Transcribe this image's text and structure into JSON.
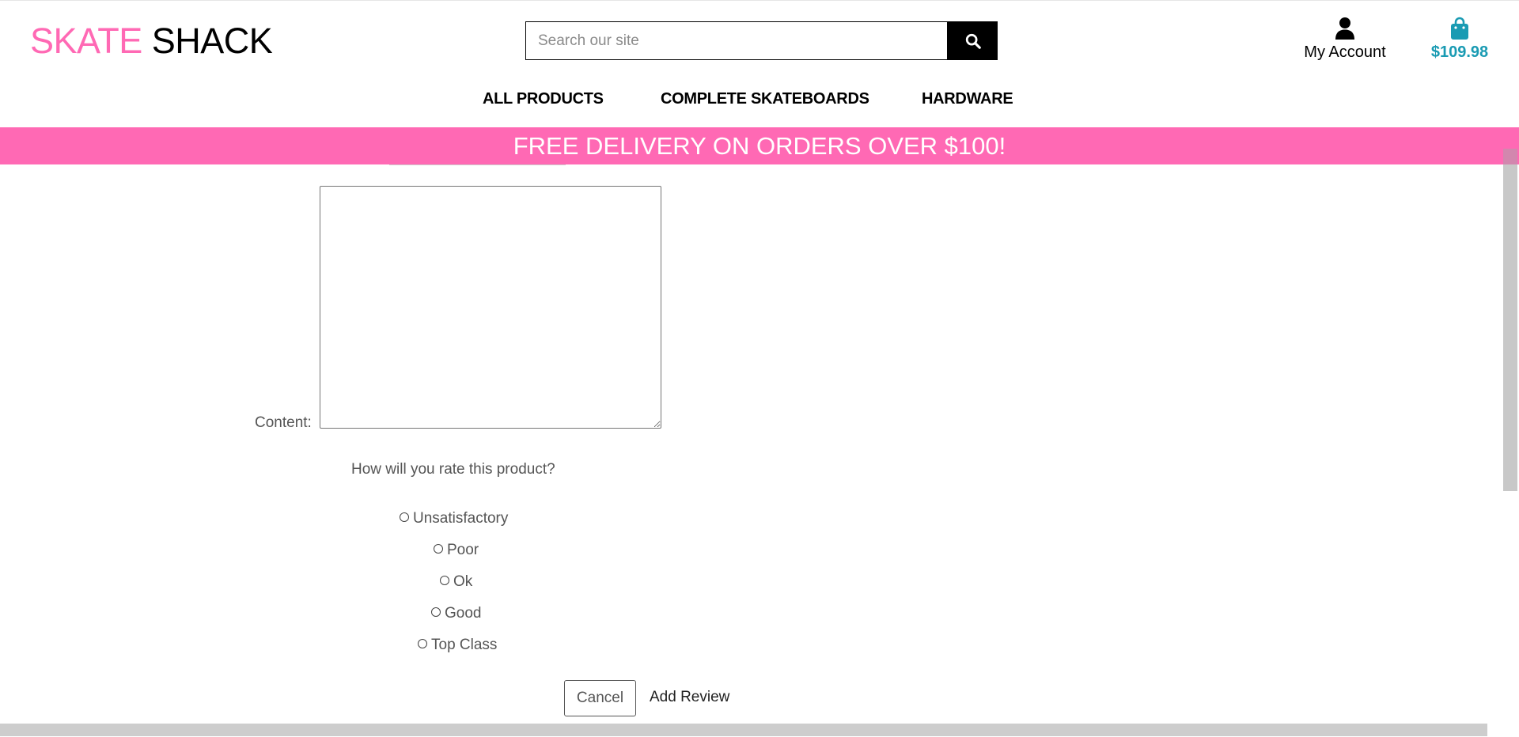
{
  "header": {
    "logo_part1": "SKATE",
    "logo_part2": "SHACK",
    "search_placeholder": "Search our site",
    "search_icon": "magnifier",
    "account_label": "My Account",
    "account_icon": "user",
    "bag_total": "$109.98",
    "bag_icon": "shopping-bag"
  },
  "nav": {
    "items": [
      "ALL PRODUCTS",
      "COMPLETE SKATEBOARDS",
      "HARDWARE"
    ]
  },
  "banner": {
    "text": "FREE DELIVERY ON ORDERS OVER $100!"
  },
  "review_form": {
    "content_label": "Content:",
    "content_value": "",
    "rating_question": "How will you rate this product?",
    "rating_options": [
      "Unsatisfactory",
      "Poor",
      "Ok",
      "Good",
      "Top Class"
    ],
    "cancel_label": "Cancel",
    "submit_label": "Add Review"
  },
  "colors": {
    "brand_pink": "#ff69b4",
    "bag_teal": "#1a9bb3",
    "text_gray": "#555555"
  }
}
